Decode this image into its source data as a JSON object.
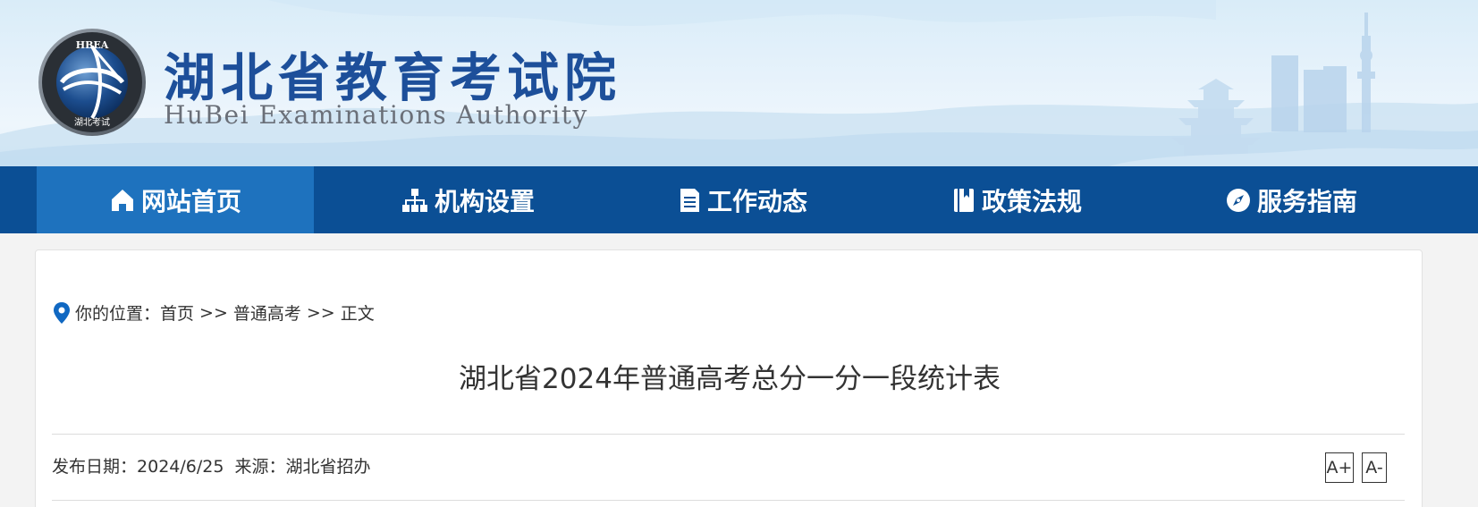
{
  "header": {
    "title_cn": "湖北省教育考试院",
    "title_en": "HuBei Examinations Authority",
    "logo": {
      "top_text": "HBEA",
      "bottom_text": "湖北考试"
    }
  },
  "nav": {
    "items": [
      {
        "label": "网站首页",
        "icon": "home-icon",
        "active": true
      },
      {
        "label": "机构设置",
        "icon": "org-chart-icon",
        "active": false
      },
      {
        "label": "工作动态",
        "icon": "document-icon",
        "active": false
      },
      {
        "label": "政策法规",
        "icon": "book-icon",
        "active": false
      },
      {
        "label": "服务指南",
        "icon": "compass-icon",
        "active": false
      }
    ]
  },
  "breadcrumb": {
    "prefix": "你的位置：",
    "items": [
      "首页",
      "普通高考",
      "正文"
    ],
    "separator": ">>"
  },
  "article": {
    "title": "湖北省2024年普通高考总分一分一段统计表",
    "date_label": "发布日期：",
    "date": "2024/6/25",
    "source_label": "来源：",
    "source": "湖北省招办"
  },
  "font_controls": {
    "increase": "A+",
    "decrease": "A-"
  },
  "colors": {
    "nav_bg": "#0b4f95",
    "nav_active": "#1e72be",
    "title_blue": "#1d4f9a"
  }
}
